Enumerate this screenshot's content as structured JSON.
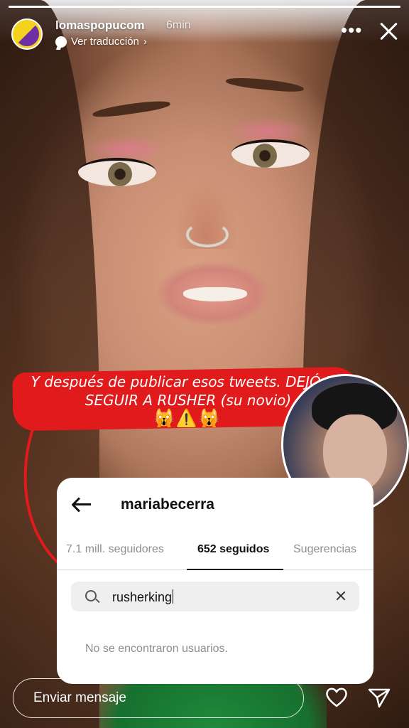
{
  "story": {
    "username": "lomaspopucom",
    "time": "6min",
    "translate_label": "Ver traducción",
    "more_label": "•••",
    "progress": 1.0
  },
  "caption": {
    "text": "Y después de publicar esos tweets. DEJÓ DE SEGUIR A RUSHER (su novio)",
    "emojis": "🙀⚠️🙀",
    "band_color": "#e11b1b"
  },
  "ig_card": {
    "profile_name": "mariabecerra",
    "tabs": [
      {
        "label": "7.1 mill. seguidores"
      },
      {
        "label": "652 seguidos",
        "active": true
      },
      {
        "label": "Sugerencias"
      }
    ],
    "search_value": "rusherking",
    "no_results": "No se encontraron usuarios."
  },
  "bottom": {
    "message_placeholder": "Enviar mensaje"
  },
  "icons": [
    "avatar",
    "translate-icon",
    "more-icon",
    "close-icon",
    "back-arrow-icon",
    "search-icon",
    "clear-icon",
    "heart-icon",
    "send-icon"
  ]
}
